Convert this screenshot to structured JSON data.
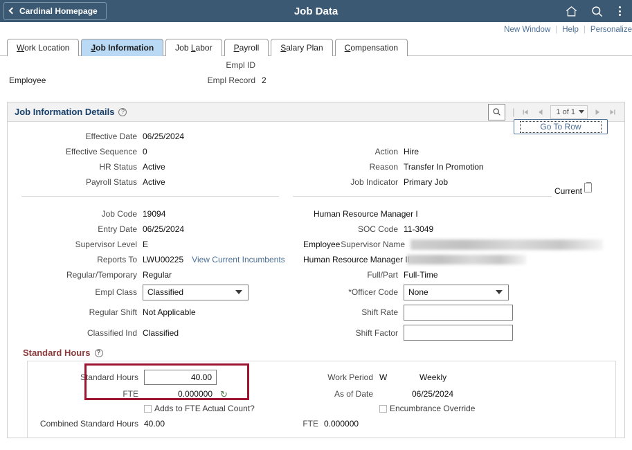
{
  "header": {
    "back_label": "Cardinal Homepage",
    "title": "Job Data",
    "icons": {
      "home": "home-icon",
      "search": "search-icon",
      "menu": "kebab-menu-icon"
    }
  },
  "utility_links": {
    "new_window": "New Window",
    "help": "Help",
    "personalize": "Personalize",
    "separator": "|"
  },
  "tabs": [
    {
      "label": "Work Location",
      "accel": "W",
      "active": false
    },
    {
      "label": "Job Information",
      "accel": "J",
      "active": true
    },
    {
      "label": "Job Labor",
      "accel": "L",
      "active": false
    },
    {
      "label": "Payroll",
      "accel": "P",
      "active": false
    },
    {
      "label": "Salary Plan",
      "accel": "S",
      "active": false
    },
    {
      "label": "Compensation",
      "accel": "C",
      "active": false
    }
  ],
  "employee_summary": {
    "role_label": "Employee",
    "empl_id_label": "Empl ID",
    "empl_id_value": "",
    "empl_record_label": "Empl Record",
    "empl_record_value": "2"
  },
  "section": {
    "title": "Job Information Details",
    "help_glyph": "?",
    "pager": {
      "search_icon": "search-icon",
      "first_label": "first-page",
      "prev_label": "previous-page",
      "position": "1 of 1",
      "next_label": "next-page",
      "last_label": "last-page",
      "divider": "|"
    }
  },
  "go_to_row": {
    "label": "Go To Row"
  },
  "current_indicator": {
    "label": "Current",
    "icon": "note-icon"
  },
  "details": {
    "left": [
      {
        "label": "Effective Date",
        "value": "06/25/2024"
      },
      {
        "label": "Effective Sequence",
        "value": "0"
      },
      {
        "label": "HR Status",
        "value": "Active"
      },
      {
        "label": "Payroll Status",
        "value": "Active"
      }
    ],
    "right": [
      {
        "label": "Action",
        "value": "Hire"
      },
      {
        "label": "Reason",
        "value": "Transfer In Promotion"
      },
      {
        "label": "Job Indicator",
        "value": "Primary Job"
      }
    ]
  },
  "job": {
    "job_code_label": "Job Code",
    "job_code_value": "19094",
    "job_title": "Human Resource Manager I",
    "entry_date_label": "Entry Date",
    "entry_date_value": "06/25/2024",
    "soc_code_label": "SOC Code",
    "soc_code_value": "11-3049",
    "supervisor_level_label": "Supervisor Level",
    "supervisor_level_value": "E",
    "employee_word": "Employee",
    "supervisor_name_label": "Supervisor Name",
    "supervisor_name_value": "",
    "reports_to_label": "Reports To",
    "reports_to_value": "LWU00225",
    "view_incumbents_link": "View Current Incumbents",
    "supervisor_title": "Human Resource Manager II",
    "supervisor_title_value": "",
    "reg_temp_label": "Regular/Temporary",
    "reg_temp_value": "Regular",
    "full_part_label": "Full/Part",
    "full_part_value": "Full-Time",
    "empl_class_label": "Empl Class",
    "empl_class_value": "Classified",
    "officer_code_label": "*Officer Code",
    "officer_code_value": "None",
    "regular_shift_label": "Regular Shift",
    "regular_shift_value": "Not Applicable",
    "shift_rate_label": "Shift Rate",
    "shift_rate_value": "",
    "classified_ind_label": "Classified Ind",
    "classified_ind_value": "Classified",
    "shift_factor_label": "Shift Factor",
    "shift_factor_value": ""
  },
  "standard_hours": {
    "title": "Standard Hours",
    "help_glyph": "?",
    "std_hours_label": "Standard Hours",
    "std_hours_value": "40.00",
    "fte_label": "FTE",
    "fte_value": "0.000000",
    "refresh_glyph": "↻",
    "adds_to_fte_label": "Adds to FTE Actual Count?",
    "adds_to_fte_checked": false,
    "combined_label": "Combined Standard Hours",
    "combined_value": "40.00",
    "combined_fte_label": "FTE",
    "combined_fte_value": "0.000000",
    "work_period_label": "Work Period",
    "work_period_code": "W",
    "work_period_desc": "Weekly",
    "as_of_date_label": "As of Date",
    "as_of_date_value": "06/25/2024",
    "encumbrance_label": "Encumbrance Override",
    "encumbrance_checked": false,
    "highlight_color": "#9c1430"
  },
  "colors": {
    "header_blue": "#3c5973",
    "tab_active": "#b9d9f5",
    "link_blue": "#4a6f96",
    "section_title": "#16406b",
    "std_hours_title": "#8a3a3a"
  }
}
